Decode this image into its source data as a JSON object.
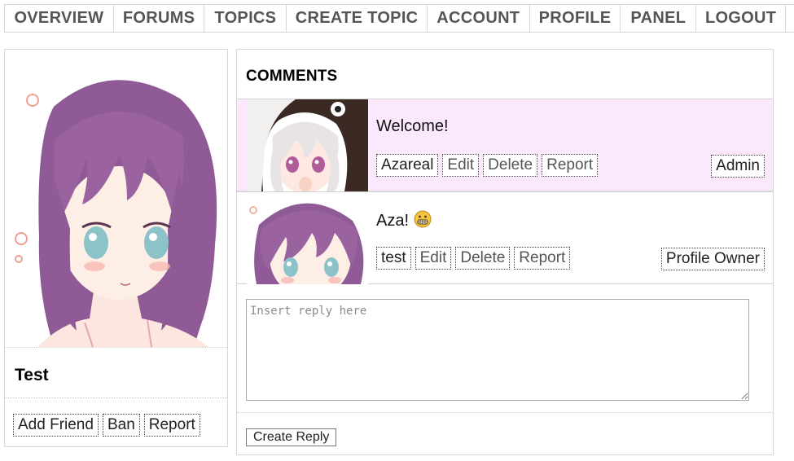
{
  "nav": {
    "items": [
      {
        "label": "OVERVIEW"
      },
      {
        "label": "FORUMS"
      },
      {
        "label": "TOPICS"
      },
      {
        "label": "CREATE TOPIC"
      },
      {
        "label": "ACCOUNT"
      },
      {
        "label": "PROFILE"
      },
      {
        "label": "PANEL"
      },
      {
        "label": "LOGOUT"
      }
    ]
  },
  "profile": {
    "name": "Test",
    "actions": {
      "add_friend": "Add Friend",
      "ban": "Ban",
      "report": "Report"
    }
  },
  "comments": {
    "title": "COMMENTS",
    "items": [
      {
        "text": "Welcome!",
        "author": "Azareal",
        "edit": "Edit",
        "delete": "Delete",
        "report": "Report",
        "role": "Admin",
        "highlight_color": "#fce8fc"
      },
      {
        "text": "Aza!",
        "emoji": "grimacing-face-icon",
        "author": "test",
        "edit": "Edit",
        "delete": "Delete",
        "report": "Report",
        "role": "Profile Owner"
      }
    ]
  },
  "reply": {
    "placeholder": "Insert reply here",
    "submit_label": "Create Reply"
  },
  "colors": {
    "nav_text": "#555555",
    "border": "#d8d8d8",
    "admin_comment_bg": "#fce8fc"
  }
}
